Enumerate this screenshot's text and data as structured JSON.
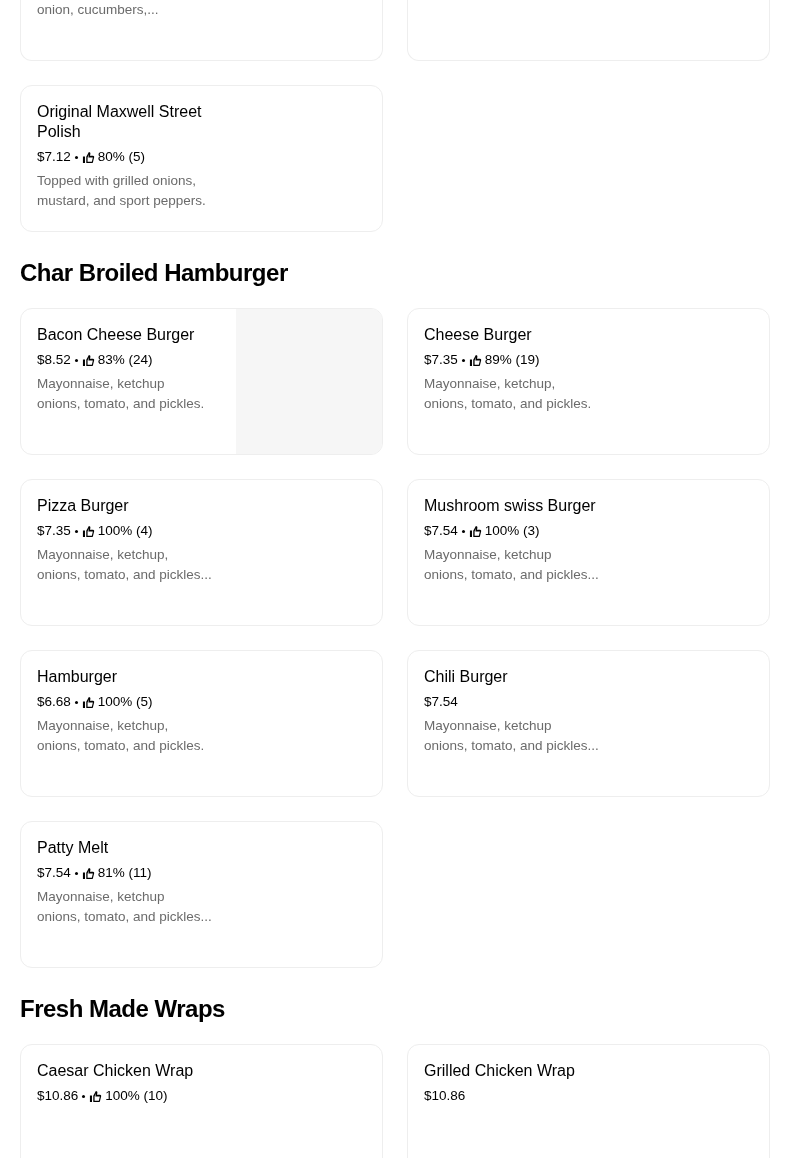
{
  "sections": [
    {
      "partial": true,
      "items": [
        {
          "description": "onion, cucumbers,..."
        }
      ]
    },
    {
      "partial": false,
      "items": [
        {
          "name": "Original Maxwell Street\nPolish",
          "price": "$7.12",
          "rating": "80% (5)",
          "description": "Topped with grilled onions,\nmustard, and sport peppers."
        }
      ]
    },
    {
      "title": "Char Broiled Hamburger",
      "partial": false,
      "items": [
        {
          "name": "Bacon Cheese Burger",
          "price": "$8.52",
          "rating": "83% (24)",
          "description": "Mayonnaise, ketchup\nonions, tomato, and pickles.",
          "has_image": true
        },
        {
          "name": "Cheese Burger",
          "price": "$7.35",
          "rating": "89% (19)",
          "description": "Mayonnaise, ketchup,\nonions, tomato, and pickles."
        },
        {
          "name": "Pizza Burger",
          "price": "$7.35",
          "rating": "100% (4)",
          "description": "Mayonnaise, ketchup,\nonions, tomato, and pickles..."
        },
        {
          "name": "Mushroom swiss Burger",
          "price": "$7.54",
          "rating": "100% (3)",
          "description": "Mayonnaise, ketchup\nonions, tomato, and pickles..."
        },
        {
          "name": "Hamburger",
          "price": "$6.68",
          "rating": "100% (5)",
          "description": "Mayonnaise, ketchup,\nonions, tomato, and pickles."
        },
        {
          "name": "Chili Burger",
          "price": "$7.54",
          "description": "Mayonnaise, ketchup\nonions, tomato, and pickles..."
        },
        {
          "name": "Patty Melt",
          "price": "$7.54",
          "rating": "81% (11)",
          "description": "Mayonnaise, ketchup\nonions, tomato, and pickles..."
        }
      ]
    },
    {
      "title": "Fresh Made Wraps",
      "partial": false,
      "items": [
        {
          "name": "Caesar Chicken Wrap",
          "price": "$10.86",
          "rating": "100% (10)"
        },
        {
          "name": "Grilled Chicken Wrap",
          "price": "$10.86"
        }
      ]
    }
  ]
}
